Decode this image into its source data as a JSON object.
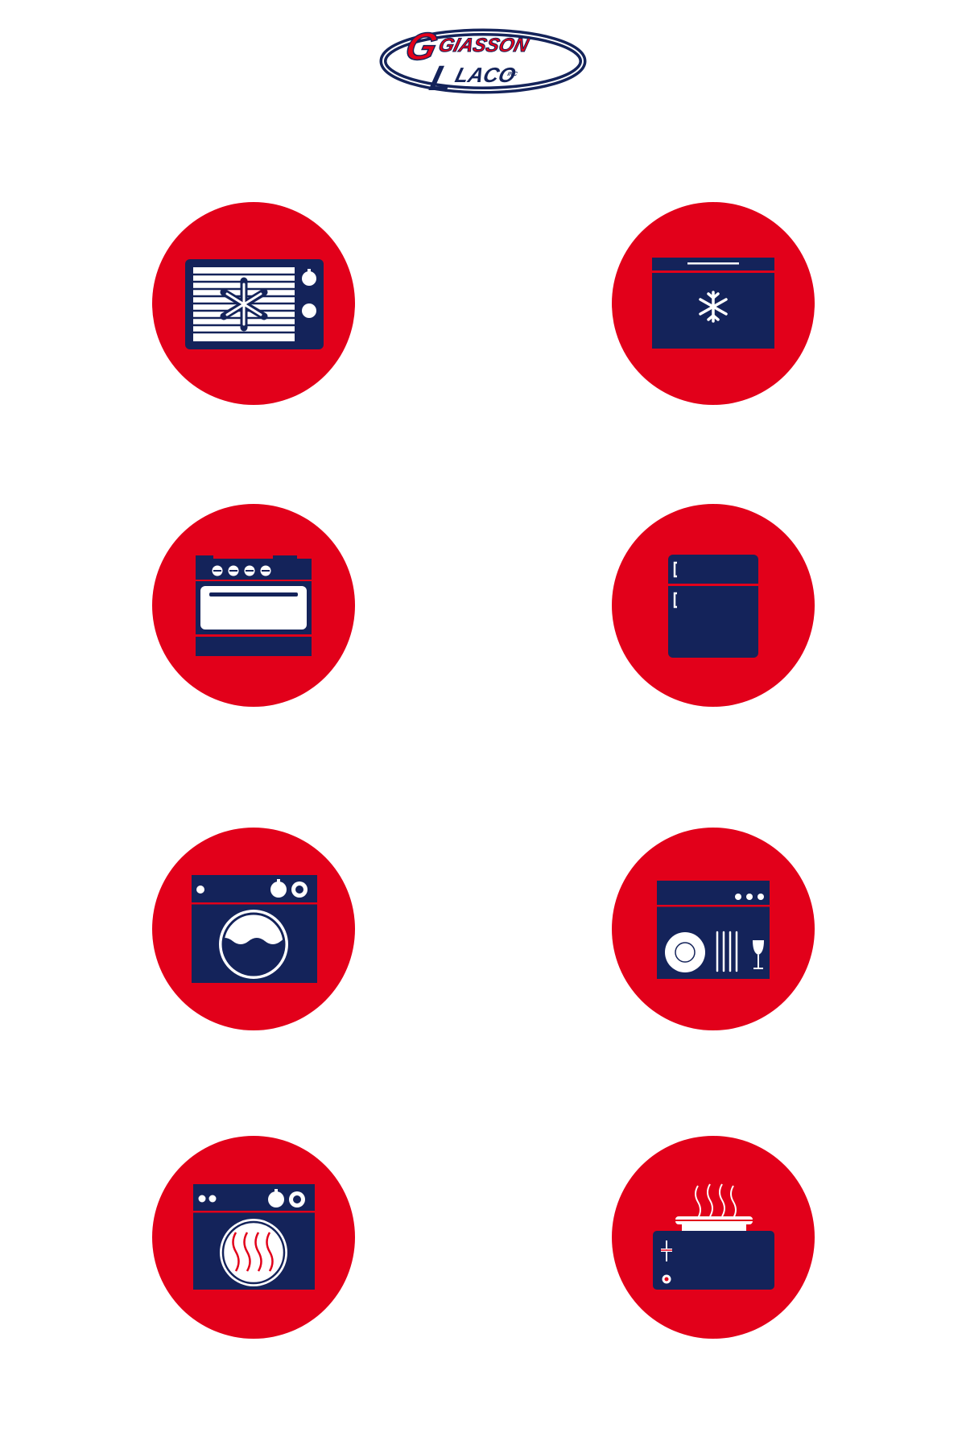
{
  "brand": {
    "logo_line1": "GIASSON",
    "logo_line2": "LACO",
    "logo_suffix": "INC"
  },
  "colors": {
    "red": "#e2001a",
    "navy": "#14235a",
    "white": "#ffffff"
  },
  "icons": [
    {
      "id": "freezer-microwave",
      "icon": "microwave-snowflake-icon"
    },
    {
      "id": "chest-freezer",
      "icon": "freezer-icon"
    },
    {
      "id": "stove",
      "icon": "stove-icon"
    },
    {
      "id": "refrigerator",
      "icon": "refrigerator-icon"
    },
    {
      "id": "washer",
      "icon": "washing-machine-icon"
    },
    {
      "id": "dishwasher",
      "icon": "dishwasher-icon"
    },
    {
      "id": "dryer",
      "icon": "dryer-icon"
    },
    {
      "id": "toaster",
      "icon": "toaster-icon"
    }
  ]
}
